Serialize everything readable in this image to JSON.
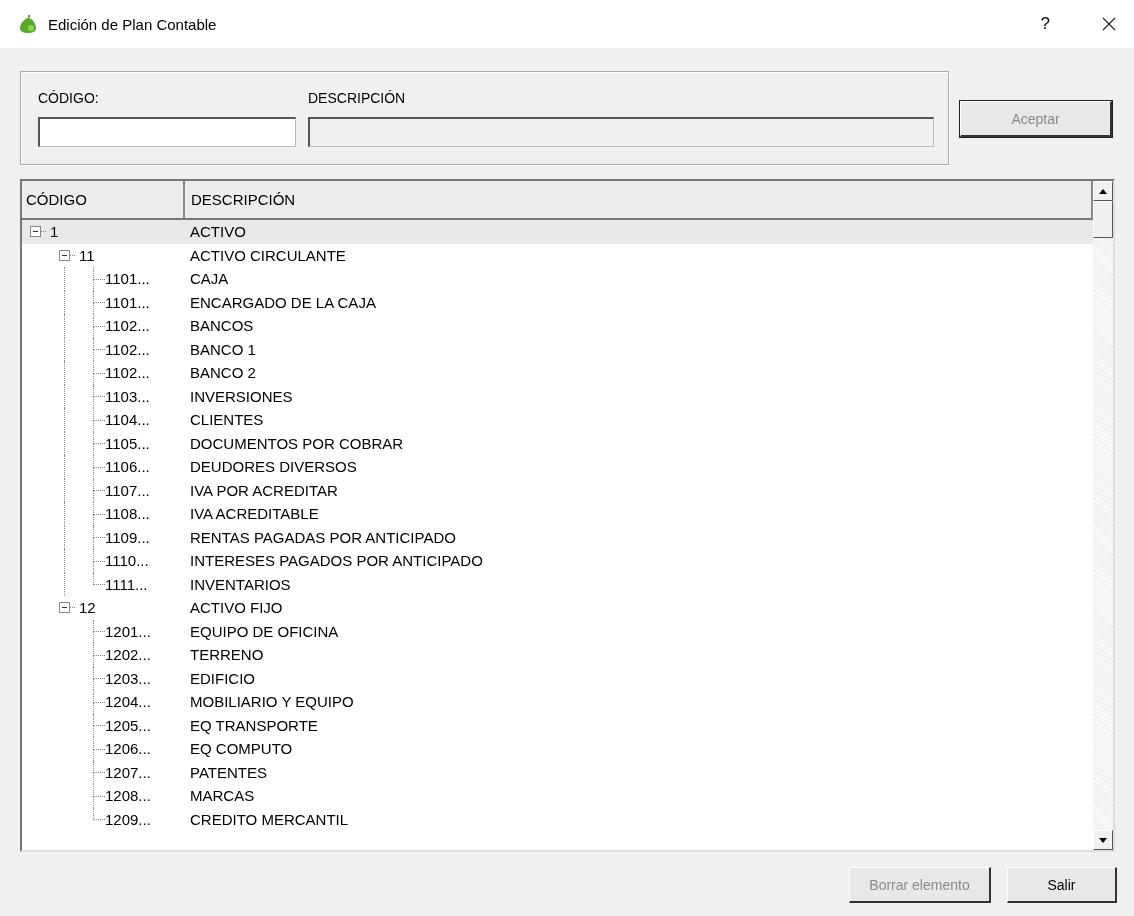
{
  "window": {
    "title": "Edición de Plan Contable",
    "help": "?"
  },
  "form": {
    "code_label": "CÓDIGO:",
    "description_label": "DESCRIPCIÓN",
    "description_disabled": true
  },
  "accept_button": {
    "label": "Aceptar",
    "disabled": true
  },
  "tree": {
    "columns": [
      "CÓDIGO",
      "DESCRIPCIÓN"
    ],
    "rows": [
      {
        "code": "1",
        "description": "ACTIVO",
        "selected": true,
        "expanded": true,
        "children": [
          {
            "code": "11",
            "description": "ACTIVO CIRCULANTE",
            "selected": false,
            "expanded": true,
            "children": [
              {
                "code": "1101...",
                "description": "CAJA",
                "selected": false
              },
              {
                "code": "1101...",
                "description": "ENCARGADO DE LA CAJA",
                "selected": false
              },
              {
                "code": "1102...",
                "description": "BANCOS",
                "selected": false
              },
              {
                "code": "1102...",
                "description": "BANCO 1",
                "selected": false
              },
              {
                "code": "1102...",
                "description": "BANCO 2",
                "selected": false
              },
              {
                "code": "1103...",
                "description": "INVERSIONES",
                "selected": false
              },
              {
                "code": "1104...",
                "description": "CLIENTES",
                "selected": false
              },
              {
                "code": "1105...",
                "description": "DOCUMENTOS POR COBRAR",
                "selected": false
              },
              {
                "code": "1106...",
                "description": "DEUDORES DIVERSOS",
                "selected": false
              },
              {
                "code": "1107...",
                "description": "IVA POR ACREDITAR",
                "selected": false
              },
              {
                "code": "1108...",
                "description": "IVA ACREDITABLE",
                "selected": false
              },
              {
                "code": "1109...",
                "description": "RENTAS PAGADAS POR ANTICIPADO",
                "selected": false
              },
              {
                "code": "1110...",
                "description": "INTERESES PAGADOS POR ANTICIPADO",
                "selected": false
              },
              {
                "code": "1111...",
                "description": "INVENTARIOS",
                "selected": false
              }
            ]
          },
          {
            "code": "12",
            "description": "ACTIVO FIJO",
            "selected": false,
            "expanded": true,
            "children": [
              {
                "code": "1201...",
                "description": "EQUIPO DE OFICINA",
                "selected": false
              },
              {
                "code": "1202...",
                "description": "TERRENO",
                "selected": false
              },
              {
                "code": "1203...",
                "description": "EDIFICIO",
                "selected": false
              },
              {
                "code": "1204...",
                "description": "MOBILIARIO Y EQUIPO",
                "selected": false
              },
              {
                "code": "1205...",
                "description": "EQ TRANSPORTE",
                "selected": false
              },
              {
                "code": "1206...",
                "description": "EQ COMPUTO",
                "selected": false
              },
              {
                "code": "1207...",
                "description": "PATENTES",
                "selected": false
              },
              {
                "code": "1208...",
                "description": "MARCAS",
                "selected": false
              },
              {
                "code": "1209...",
                "description": "CREDITO MERCANTIL",
                "selected": false
              }
            ]
          }
        ]
      }
    ]
  },
  "buttons": [
    {
      "label": "Borrar elemento",
      "disabled": true
    },
    {
      "label": "Salir",
      "disabled": false
    }
  ]
}
